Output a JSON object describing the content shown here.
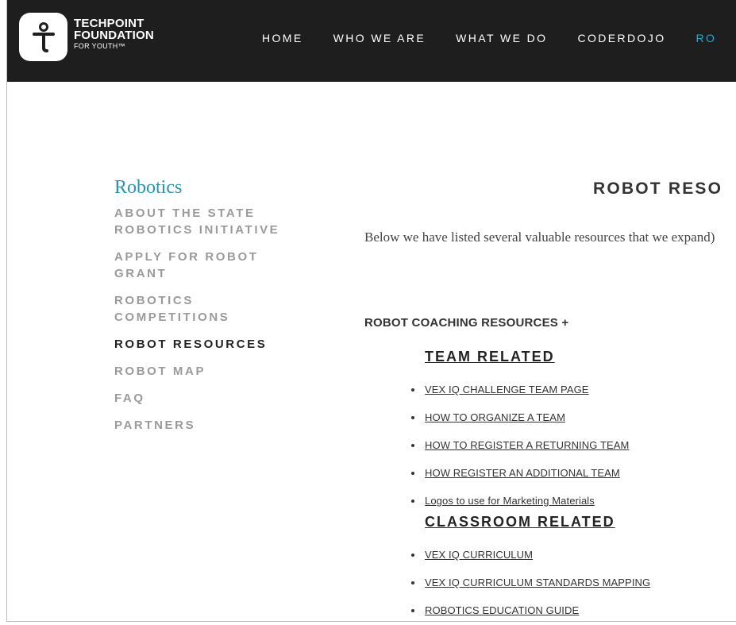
{
  "brand": {
    "line1": "TECHPOINT",
    "line2": "FOUNDATION",
    "line3": "FOR YOUTH™"
  },
  "nav": [
    {
      "label": "HOME"
    },
    {
      "label": "WHO WE ARE"
    },
    {
      "label": "WHAT WE DO"
    },
    {
      "label": "CODERDOJO"
    },
    {
      "label": "RO"
    }
  ],
  "sidebar": {
    "title": "Robotics",
    "items": [
      {
        "label": "ABOUT THE STATE ROBOTICS INITIATIVE"
      },
      {
        "label": "APPLY FOR ROBOT GRANT"
      },
      {
        "label": "ROBOTICS COMPETITIONS"
      },
      {
        "label": "ROBOT RESOURCES"
      },
      {
        "label": "ROBOT MAP"
      },
      {
        "label": "FAQ"
      },
      {
        "label": "PARTNERS"
      }
    ]
  },
  "main": {
    "title": "ROBOT RESO",
    "intro": "Below we have listed several valuable resources that we expand)",
    "section_heading": "ROBOT COACHING RESOURCES +",
    "team_heading": "TEAM RELATED",
    "team_links": [
      "VEX IQ CHALLENGE TEAM PAGE",
      "HOW TO ORGANIZE A TEAM",
      "HOW TO REGISTER A RETURNING TEAM",
      "HOW REGISTER AN ADDITIONAL TEAM",
      "Logos to use for Marketing Materials"
    ],
    "classroom_heading": "CLASSROOM RELATED",
    "classroom_links": [
      "VEX IQ CURRICULUM",
      "VEX IQ CURRICULUM STANDARDS MAPPING",
      "ROBOTICS EDUCATION GUIDE"
    ]
  },
  "colors": {
    "header_bg": "#1e1e1e",
    "nav_active": "#2aa7c9",
    "sidebar_title": "#2a93ad",
    "sidebar_inactive": "#9a9a9a",
    "sidebar_active": "#222222"
  },
  "icons": {
    "logo": "figure-with-cross-icon"
  }
}
